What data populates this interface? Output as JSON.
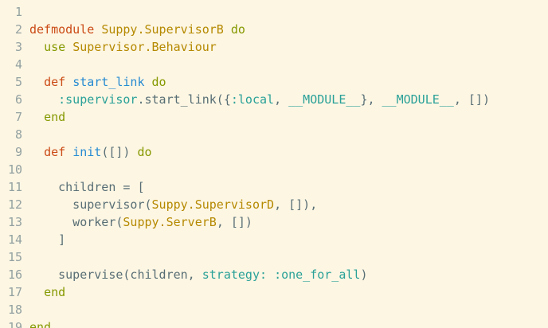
{
  "colors": {
    "background": "#fdf6e3",
    "gutter": "#93a1a1",
    "plain": "#586e75",
    "keyword_red": "#cb4b16",
    "keyword_olive": "#859900",
    "function_blue": "#268bd2",
    "module_yellow": "#b58900",
    "atom_cyan": "#2aa198"
  },
  "line_numbers": [
    "1",
    "2",
    "3",
    "4",
    "5",
    "6",
    "7",
    "8",
    "9",
    "10",
    "11",
    "12",
    "13",
    "14",
    "15",
    "16",
    "17",
    "18",
    "19"
  ],
  "lines": [
    [],
    [
      {
        "t": "defmodule",
        "c": "keyword_red"
      },
      {
        "t": " ",
        "c": "plain"
      },
      {
        "t": "Suppy.SupervisorB",
        "c": "module_yellow"
      },
      {
        "t": " ",
        "c": "plain"
      },
      {
        "t": "do",
        "c": "keyword_olive"
      }
    ],
    [
      {
        "t": "  ",
        "c": "plain"
      },
      {
        "t": "use",
        "c": "keyword_olive"
      },
      {
        "t": " ",
        "c": "plain"
      },
      {
        "t": "Supervisor.Behaviour",
        "c": "module_yellow"
      }
    ],
    [],
    [
      {
        "t": "  ",
        "c": "plain"
      },
      {
        "t": "def",
        "c": "keyword_red"
      },
      {
        "t": " ",
        "c": "plain"
      },
      {
        "t": "start_link",
        "c": "function_blue"
      },
      {
        "t": " ",
        "c": "plain"
      },
      {
        "t": "do",
        "c": "keyword_olive"
      }
    ],
    [
      {
        "t": "    ",
        "c": "plain"
      },
      {
        "t": ":supervisor",
        "c": "atom_cyan"
      },
      {
        "t": ".start_link({",
        "c": "plain"
      },
      {
        "t": ":local",
        "c": "atom_cyan"
      },
      {
        "t": ", ",
        "c": "plain"
      },
      {
        "t": "__MODULE__",
        "c": "atom_cyan"
      },
      {
        "t": "}, ",
        "c": "plain"
      },
      {
        "t": "__MODULE__",
        "c": "atom_cyan"
      },
      {
        "t": ", [])",
        "c": "plain"
      }
    ],
    [
      {
        "t": "  ",
        "c": "plain"
      },
      {
        "t": "end",
        "c": "keyword_olive"
      }
    ],
    [],
    [
      {
        "t": "  ",
        "c": "plain"
      },
      {
        "t": "def",
        "c": "keyword_red"
      },
      {
        "t": " ",
        "c": "plain"
      },
      {
        "t": "init",
        "c": "function_blue"
      },
      {
        "t": "([]) ",
        "c": "plain"
      },
      {
        "t": "do",
        "c": "keyword_olive"
      }
    ],
    [],
    [
      {
        "t": "    children = [",
        "c": "plain"
      }
    ],
    [
      {
        "t": "      supervisor(",
        "c": "plain"
      },
      {
        "t": "Suppy.SupervisorD",
        "c": "module_yellow"
      },
      {
        "t": ", []),",
        "c": "plain"
      }
    ],
    [
      {
        "t": "      worker(",
        "c": "plain"
      },
      {
        "t": "Suppy.ServerB",
        "c": "module_yellow"
      },
      {
        "t": ", [])",
        "c": "plain"
      }
    ],
    [
      {
        "t": "    ]",
        "c": "plain"
      }
    ],
    [],
    [
      {
        "t": "    supervise(children, ",
        "c": "plain"
      },
      {
        "t": "strategy:",
        "c": "atom_cyan"
      },
      {
        "t": " ",
        "c": "plain"
      },
      {
        "t": ":one_for_all",
        "c": "atom_cyan"
      },
      {
        "t": ")",
        "c": "plain"
      }
    ],
    [
      {
        "t": "  ",
        "c": "plain"
      },
      {
        "t": "end",
        "c": "keyword_olive"
      }
    ],
    [],
    [
      {
        "t": "end",
        "c": "keyword_olive"
      }
    ]
  ]
}
